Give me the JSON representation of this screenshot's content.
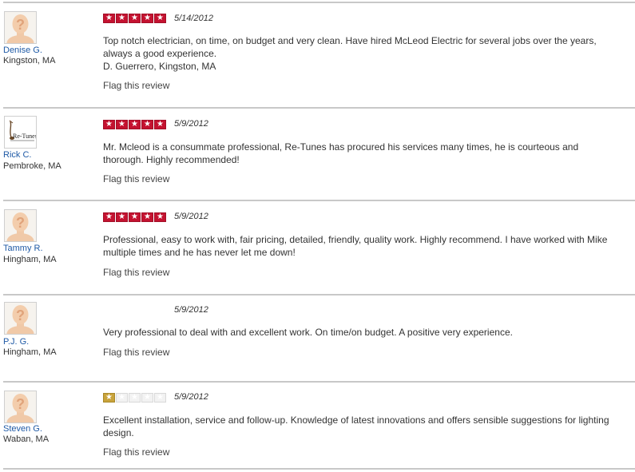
{
  "reviews": [
    {
      "name": "Denise G.",
      "location": "Kingston, MA",
      "avatar": "default-person-icon",
      "rating": 5,
      "star_style": "red",
      "date": "5/14/2012",
      "text": [
        "Top notch electrician, on time, on budget and very clean.  Have hired McLeod Electric for several jobs over the years,",
        "always a good experience.",
        "D. Guerrero, Kingston, MA"
      ],
      "flag": "Flag this review"
    },
    {
      "name": "Rick C.",
      "location": "Pembroke, MA",
      "avatar": "re-tunes-logo",
      "avatar_text": "Re-Tunes",
      "rating": 5,
      "star_style": "red",
      "date": "5/9/2012",
      "text": [
        "Mr. Mcleod is a consummate professional, Re-Tunes has procured his services many times, he is courteous and",
        "thorough. Highly recommended!"
      ],
      "flag": "Flag this review"
    },
    {
      "name": "Tammy R.",
      "location": "Hingham, MA",
      "avatar": "default-person-icon",
      "rating": 5,
      "star_style": "red",
      "date": "5/9/2012",
      "text": [
        "Professional, easy to work with, fair pricing, detailed, friendly, quality work.  Highly recommend.  I have worked with Mike",
        "multiple times and he has never let me down!"
      ],
      "flag": "Flag this review"
    },
    {
      "name": "P.J. G.",
      "location": "Hingham, MA",
      "avatar": "default-person-icon",
      "rating": 0,
      "star_style": "none",
      "date": "5/9/2012",
      "text": [
        "Very professional to deal with and excellent work.  On time/on budget.  A positive very experience."
      ],
      "flag": "Flag this review"
    },
    {
      "name": "Steven G.",
      "location": "Waban, MA",
      "avatar": "default-person-icon",
      "rating": 1,
      "star_style": "gold",
      "date": "5/9/2012",
      "text": [
        "Excellent installation, service and follow-up.  Knowledge of latest innovations and offers sensible suggestions for lighting",
        "design."
      ],
      "flag": "Flag this review"
    }
  ],
  "colors": {
    "star_red": "#c41230",
    "star_gold": "#c9a33b",
    "name_link": "#1f5aa6",
    "separator": "#c8c8c8"
  }
}
